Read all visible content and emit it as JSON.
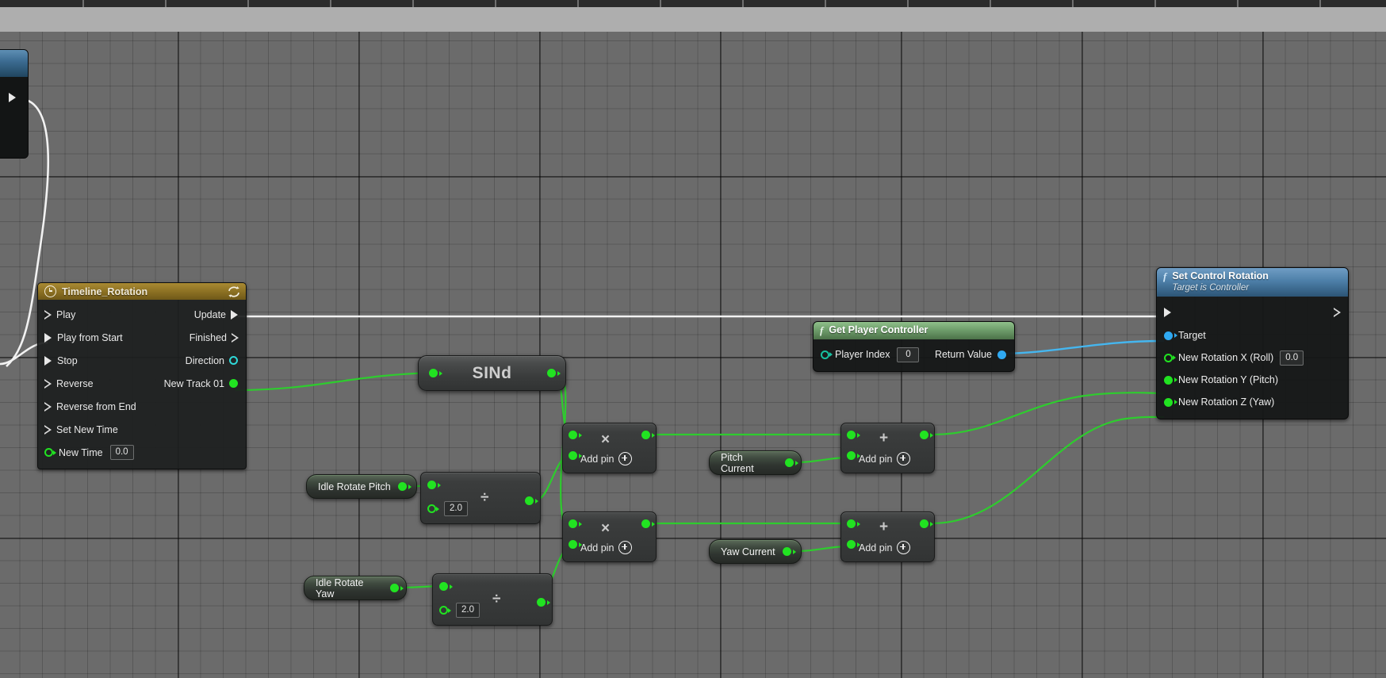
{
  "app": {
    "kind": "blueprint-graph",
    "background_color": "#6b6b6b"
  },
  "nodes": {
    "offscreen_stub": {
      "name": "offscreen-event-node"
    },
    "timeline": {
      "title": "Timeline_Rotation",
      "icon": "clock-icon",
      "loop_icon": "loop-icon",
      "header_color": "#8a6f22",
      "inputs": [
        {
          "label": "Play",
          "pin": "exec-hollow"
        },
        {
          "label": "Play from Start",
          "pin": "exec-filled"
        },
        {
          "label": "Stop",
          "pin": "exec-filled"
        },
        {
          "label": "Reverse",
          "pin": "exec-hollow"
        },
        {
          "label": "Reverse from End",
          "pin": "exec-hollow"
        },
        {
          "label": "Set New Time",
          "pin": "exec-hollow"
        }
      ],
      "new_time": {
        "label": "New Time",
        "value": "0.0",
        "pin": "hollow-green"
      },
      "outputs": [
        {
          "label": "Update",
          "pin": "exec-filled"
        },
        {
          "label": "Finished",
          "pin": "exec-hollow"
        },
        {
          "label": "Direction",
          "pin": "hollow-cyan"
        },
        {
          "label": "New Track 01",
          "pin": "filled-green"
        }
      ]
    },
    "sind": {
      "label": "SINd"
    },
    "get_player_controller": {
      "title": "Get Player Controller",
      "subtitle": "",
      "icon": "function-icon",
      "header_color": "#6f9e6c",
      "input": {
        "label": "Player Index",
        "value": "0",
        "pin": "hollow-teal"
      },
      "output": {
        "label": "Return Value",
        "pin": "filled-blue"
      }
    },
    "set_control_rotation": {
      "title": "Set Control Rotation",
      "subtitle": "Target is Controller",
      "icon": "function-icon",
      "header_color": "#4d7fa8",
      "rows": [
        {
          "label": "Target",
          "pin": "filled-blue"
        },
        {
          "label": "New Rotation X (Roll)",
          "pin": "hollow-green",
          "value": "0.0"
        },
        {
          "label": "New Rotation Y (Pitch)",
          "pin": "filled-green"
        },
        {
          "label": "New Rotation Z (Yaw)",
          "pin": "filled-green"
        }
      ]
    },
    "multiply_pitch": {
      "op": "×",
      "add_pin_label": "Add pin"
    },
    "multiply_yaw": {
      "op": "×",
      "add_pin_label": "Add pin"
    },
    "add_pitch": {
      "op": "+",
      "add_pin_label": "Add pin"
    },
    "add_yaw": {
      "op": "+",
      "add_pin_label": "Add pin"
    },
    "divide_pitch": {
      "op": "÷",
      "value": "2.0"
    },
    "divide_yaw": {
      "op": "÷",
      "value": "2.0"
    },
    "var_idle_rotate_pitch": {
      "label": "Idle Rotate Pitch"
    },
    "var_idle_rotate_yaw": {
      "label": "Idle Rotate Yaw"
    },
    "var_pitch_current": {
      "label": "Pitch Current"
    },
    "var_yaw_current": {
      "label": "Yaw Current"
    }
  },
  "colors": {
    "exec_wire": "#f2f2f2",
    "float_wire": "#2ecc2e",
    "object_wire": "#45b6ef",
    "grid": "#6b6b6b"
  }
}
